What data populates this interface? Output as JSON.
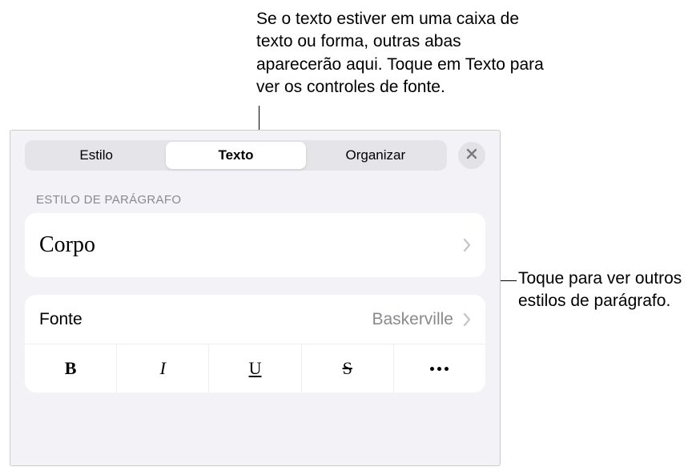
{
  "annotations": {
    "top": "Se o texto estiver em uma caixa de texto ou forma, outras abas aparecerão aqui. Toque em Texto para ver os controles de fonte.",
    "right": "Toque para ver outros estilos de parágrafo."
  },
  "tabs": {
    "style": "Estilo",
    "text": "Texto",
    "arrange": "Organizar"
  },
  "section": {
    "paragraph_style_label": "ESTILO DE PARÁGRAFO"
  },
  "paragraph_style": {
    "name": "Corpo"
  },
  "font": {
    "label": "Fonte",
    "value": "Baskerville"
  },
  "format_buttons": {
    "bold": "B",
    "italic": "I",
    "underline": "U",
    "strike": "S"
  }
}
